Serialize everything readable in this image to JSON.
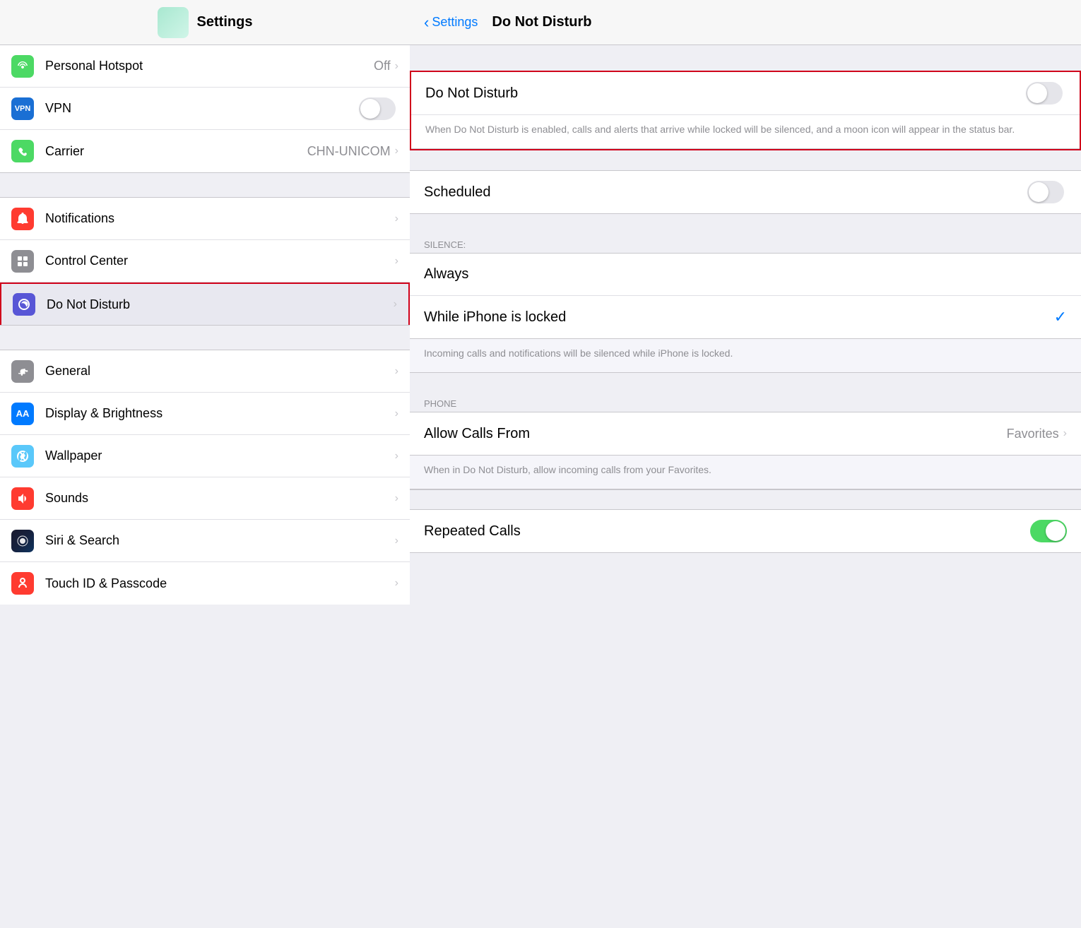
{
  "left": {
    "header": {
      "title": "Settings"
    },
    "topSection": [
      {
        "id": "personal-hotspot",
        "label": "Personal Hotspot",
        "value": "Off",
        "hasChevron": true,
        "iconColor": "icon-green",
        "iconSymbol": "📶"
      },
      {
        "id": "vpn",
        "label": "VPN",
        "hasToggle": true,
        "iconText": "VPN",
        "iconIsVPN": true
      },
      {
        "id": "carrier",
        "label": "Carrier",
        "value": "CHN-UNICOM",
        "hasChevron": true,
        "iconColor": "icon-phone-green",
        "iconSymbol": "📞"
      }
    ],
    "middleSection": [
      {
        "id": "notifications",
        "label": "Notifications",
        "hasChevron": true,
        "iconColor": "icon-red",
        "iconSymbol": "🔔"
      },
      {
        "id": "control-center",
        "label": "Control Center",
        "hasChevron": true,
        "iconColor": "icon-gray",
        "iconSymbol": "⚙"
      },
      {
        "id": "do-not-disturb",
        "label": "Do Not Disturb",
        "hasChevron": true,
        "iconColor": "icon-purple",
        "iconSymbol": "🌙",
        "highlighted": true
      }
    ],
    "bottomSection": [
      {
        "id": "general",
        "label": "General",
        "hasChevron": true,
        "iconColor": "icon-gray",
        "iconSymbol": "⚙"
      },
      {
        "id": "display-brightness",
        "label": "Display & Brightness",
        "hasChevron": true,
        "iconColor": "icon-display",
        "iconSymbol": "AA"
      },
      {
        "id": "wallpaper",
        "label": "Wallpaper",
        "hasChevron": true,
        "iconColor": "icon-teal",
        "iconSymbol": "✳"
      },
      {
        "id": "sounds",
        "label": "Sounds",
        "hasChevron": true,
        "iconColor": "icon-red",
        "iconSymbol": "🔊"
      },
      {
        "id": "siri-search",
        "label": "Siri & Search",
        "hasChevron": true,
        "iconColor": "icon-siri",
        "iconSymbol": "◎"
      },
      {
        "id": "touch-id",
        "label": "Touch ID & Passcode",
        "hasChevron": true,
        "iconColor": "icon-touchid",
        "iconSymbol": "◎"
      }
    ]
  },
  "right": {
    "header": {
      "backLabel": "Settings",
      "title": "Do Not Disturb"
    },
    "doNotDisturbToggleLabel": "Do Not Disturb",
    "doNotDisturbDesc": "When Do Not Disturb is enabled, calls and alerts that arrive while locked will be silenced, and a moon icon will appear in the status bar.",
    "scheduledLabel": "Scheduled",
    "silenceHeader": "SILENCE:",
    "alwaysLabel": "Always",
    "whileLockedLabel": "While iPhone is locked",
    "whileLockedDesc": "Incoming calls and notifications will be silenced while iPhone is locked.",
    "phoneHeader": "PHONE",
    "allowCallsLabel": "Allow Calls From",
    "allowCallsValue": "Favorites",
    "allowCallsDesc": "When in Do Not Disturb, allow incoming calls from your Favorites.",
    "repeatedCallsLabel": "Repeated Calls"
  }
}
